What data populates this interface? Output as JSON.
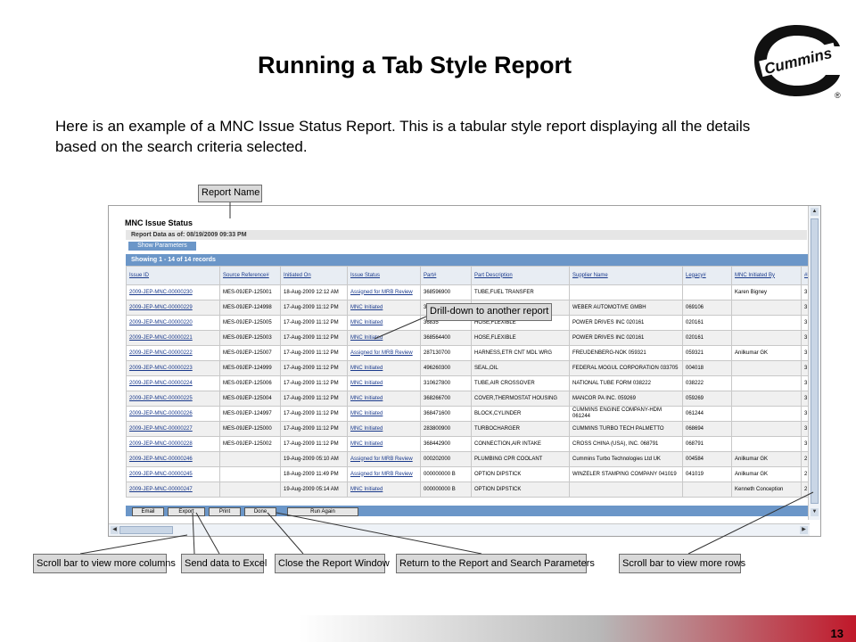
{
  "slide": {
    "title": "Running a Tab Style Report",
    "intro": "Here is an example of a MNC Issue Status Report.  This is a tabular style report displaying all the details based on the search criteria selected.",
    "page_number": "13",
    "logo_text": "Cummins"
  },
  "callouts": {
    "report_name": "Report Name",
    "drill_down": "Drill-down to another report",
    "scroll_columns": "Scroll bar to view more columns",
    "send_excel": "Send data to Excel",
    "close_window": "Close the Report Window",
    "return_params": "Return to the Report and Search Parameters",
    "scroll_rows": "Scroll bar to view more rows"
  },
  "report": {
    "title": "MNC Issue Status",
    "as_of": "Report Data as of: 08/19/2009 09:33 PM",
    "show_parameters": "Show Parameters",
    "showing": "Showing 1 - 14 of 14 records",
    "columns": [
      "Issue ID",
      "Source Reference#",
      "Initiated On",
      "Issue Status",
      "Part#",
      "Part Description",
      "Supplier Name",
      "Legacy#",
      "MNC Initiated By",
      "#D"
    ],
    "rows": [
      [
        "2009-JEP-MNC-00000230",
        "MES-09JEP-125001",
        "18-Aug-2009 12:12 AM",
        "Assigned for MRB Review",
        "368596900",
        "TUBE,FUEL TRANSFER",
        "",
        "",
        "Karen Bigney",
        "3"
      ],
      [
        "2009-JEP-MNC-00000229",
        "MES-09JEP-124998",
        "17-Aug-2009 11:12 PM",
        "MNC Initiated",
        "3",
        "",
        "WEBER AUTOMOTIVE GMBH",
        "069106",
        "",
        "3"
      ],
      [
        "2009-JEP-MNC-00000220",
        "MES-09JEP-125005",
        "17-Aug-2009 11:12 PM",
        "MNC Initiated",
        "36835",
        "HOSE,FLEXIBLE",
        "POWER DRIVES INC 020161",
        "020161",
        "",
        "3"
      ],
      [
        "2009-JEP-MNC-00000221",
        "MES-09JEP-125003",
        "17-Aug-2009 11:12 PM",
        "MNC Initiated",
        "368564400",
        "HOSE,FLEXIBLE",
        "POWER DRIVES INC 020161",
        "020161",
        "",
        "3"
      ],
      [
        "2009-JEP-MNC-00000222",
        "MES-09JEP-125007",
        "17-Aug-2009 11:12 PM",
        "Assigned for MRB Review",
        "287130700",
        "HARNESS,ETR CNT MDL WRG",
        "FREUDENBERG-NOK 059321",
        "059321",
        "Anilkumar GK",
        "3"
      ],
      [
        "2009-JEP-MNC-00000223",
        "MES-09JEP-124999",
        "17-Aug-2009 11:12 PM",
        "MNC Initiated",
        "496260300",
        "SEAL,OIL",
        "FEDERAL MOGUL CORPORATION 033705",
        "004018",
        "",
        "3"
      ],
      [
        "2009-JEP-MNC-00000224",
        "MES-09JEP-125006",
        "17-Aug-2009 11:12 PM",
        "MNC Initiated",
        "310627800",
        "TUBE,AIR CROSSOVER",
        "NATIONAL TUBE FORM 038222",
        "038222",
        "",
        "3"
      ],
      [
        "2009-JEP-MNC-00000225",
        "MES-09JEP-125004",
        "17-Aug-2009 11:12 PM",
        "MNC Initiated",
        "368266700",
        "COVER,THERMOSTAT HOUSING",
        "MANCOR PA INC. 059269",
        "059269",
        "",
        "3"
      ],
      [
        "2009-JEP-MNC-00000226",
        "MES-09JEP-124997",
        "17-Aug-2009 11:12 PM",
        "MNC Initiated",
        "368471600",
        "BLOCK,CYLINDER",
        "CUMMINS ENGINE COMPANY-HDM 061244",
        "061244",
        "",
        "3"
      ],
      [
        "2009-JEP-MNC-00000227",
        "MES-09JEP-125000",
        "17-Aug-2009 11:12 PM",
        "MNC Initiated",
        "283800900",
        "TURBOCHARGER",
        "CUMMINS TURBO TECH PALMETTO",
        "068694",
        "",
        "3"
      ],
      [
        "2009-JEP-MNC-00000228",
        "MES-09JEP-125002",
        "17-Aug-2009 11:12 PM",
        "MNC Initiated",
        "368442900",
        "CONNECTION,AIR INTAKE",
        "CROSS CHINA (USA), INC. 068791",
        "068791",
        "",
        "3"
      ],
      [
        "2009-JEP-MNC-00000246",
        "",
        "19-Aug-2009 05:10 AM",
        "Assigned for MRB Review",
        "000202000",
        "PLUMBING CPR COOLANT",
        "Cummins Turbo Technologies Ltd UK",
        "004584",
        "Anilkumar GK",
        "2"
      ],
      [
        "2009-JEP-MNC-00000245",
        "",
        "18-Aug-2009 11:49 PM",
        "Assigned for MRB Review",
        "000000000 B",
        "OPTION DIPSTICK",
        "WINZELER STAMPING COMPANY 041019",
        "041019",
        "Anilkumar GK",
        "2"
      ],
      [
        "2009-JEP-MNC-00000247",
        "",
        "19-Aug-2009 05:14 AM",
        "MNC Initiated",
        "000000000 B",
        "OPTION DIPSTICK",
        "",
        "",
        "Kenneth Conception",
        "2"
      ]
    ],
    "buttons": {
      "email": "Email",
      "export": "Export",
      "print": "Print",
      "done": "Done",
      "run_again": "Run Again"
    }
  }
}
